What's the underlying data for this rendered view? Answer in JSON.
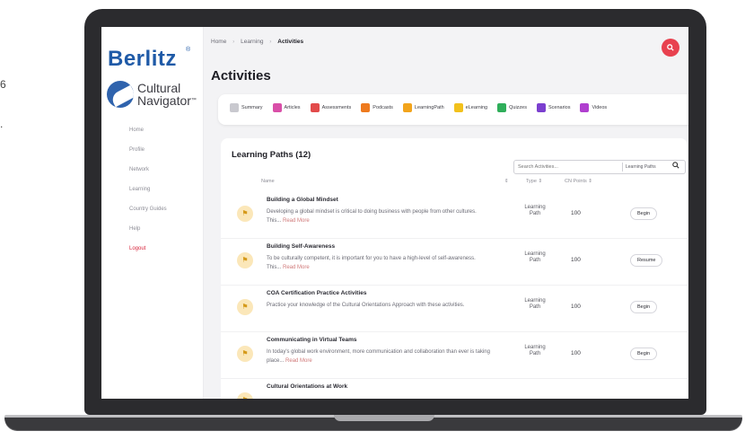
{
  "edge_text": {
    "line1": "6",
    "line2": "."
  },
  "sidebar": {
    "brand": "Berlitz",
    "brand_mark": "®",
    "product_line1": "Cultural",
    "product_line2": "Navigator",
    "product_mark": "™",
    "items": [
      {
        "label": "Home"
      },
      {
        "label": "Profile"
      },
      {
        "label": "Network"
      },
      {
        "label": "Learning"
      },
      {
        "label": "Country Guides"
      },
      {
        "label": "Help"
      },
      {
        "label": "Logout"
      }
    ]
  },
  "breadcrumb": {
    "home": "Home",
    "learning": "Learning",
    "current": "Activities"
  },
  "header": {
    "title": "Activities",
    "search_icon": "magnifier"
  },
  "tabs": [
    {
      "label": "Summary",
      "color": "#c9c9cf"
    },
    {
      "label": "Articles",
      "color": "#d94fa8"
    },
    {
      "label": "Assessments",
      "color": "#e24b4b"
    },
    {
      "label": "Podcasts",
      "color": "#ee7a1e"
    },
    {
      "label": "LearningPath",
      "color": "#f2a41c"
    },
    {
      "label": "eLearning",
      "color": "#f2c11c"
    },
    {
      "label": "Quizzes",
      "color": "#2fae5a"
    },
    {
      "label": "Scenarios",
      "color": "#7b3fcf"
    },
    {
      "label": "Videos",
      "color": "#b03fcf"
    }
  ],
  "learning_paths": {
    "title": "Learning Paths (12)",
    "search_placeholder": "Search Activities...",
    "search_type": "Learning Paths",
    "columns": {
      "name": "Name",
      "sort": "⇕",
      "type": "Type ⇕",
      "points": "CN Points ⇕"
    },
    "rows": [
      {
        "title": "Building a Global Mindset",
        "desc": "Developing a global mindset is critical to doing business with people from other cultures. This...",
        "more": "Read More",
        "type_line1": "Learning",
        "type_line2": "Path",
        "points": "100",
        "action": "Begin"
      },
      {
        "title": "Building Self-Awareness",
        "desc": "To be culturally competent, it is important for you to have a high-level of self-awareness. This...",
        "more": "Read More",
        "type_line1": "Learning",
        "type_line2": "Path",
        "points": "100",
        "action": "Resume"
      },
      {
        "title": "COA Certification Practice Activities",
        "desc": "Practice your knowledge of the Cultural Orientations Approach with these activities.",
        "more": "",
        "type_line1": "Learning",
        "type_line2": "Path",
        "points": "100",
        "action": "Begin"
      },
      {
        "title": "Communicating in Virtual Teams",
        "desc": "In today's global work environment, more communication and collaboration than ever is taking place...",
        "more": "Read More",
        "type_line1": "Learning",
        "type_line2": "Path",
        "points": "100",
        "action": "Begin"
      },
      {
        "title": "Cultural Orientations at Work",
        "desc": "",
        "more": "",
        "type_line1": "",
        "type_line2": "",
        "points": "",
        "action": ""
      }
    ]
  }
}
